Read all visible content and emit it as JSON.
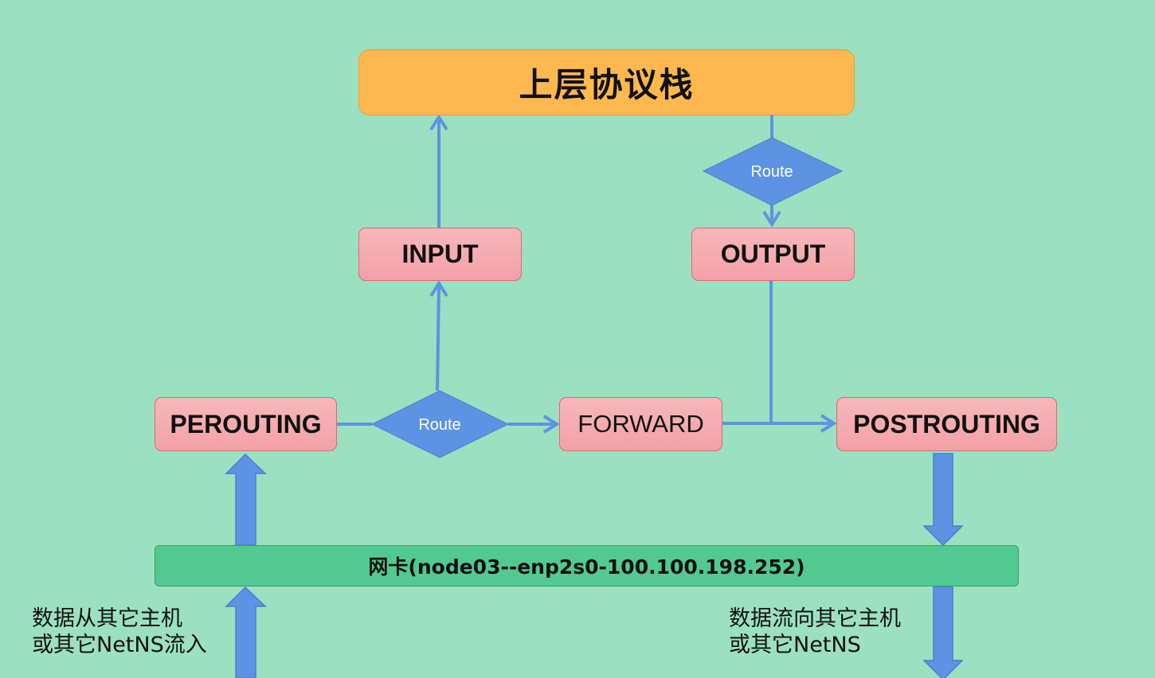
{
  "top_box": {
    "label": "上层协议栈"
  },
  "chains": {
    "input": "INPUT",
    "output": "OUTPUT",
    "prerouting": "PEROUTING",
    "forward": "FORWARD",
    "postrouting": "POSTROUTING"
  },
  "route_nodes": {
    "upper": "Route",
    "lower": "Route"
  },
  "nic": {
    "label": "网卡(node03--enp2s0-100.100.198.252)"
  },
  "notes": {
    "inbound": [
      "数据从其它主机",
      "或其它NetNS流入"
    ],
    "outbound": [
      "数据流向其它主机",
      "或其它NetNS"
    ]
  },
  "colors": {
    "background": "#9be0c1",
    "chain_fill": "#f4a9ae",
    "chain_border": "#e46670",
    "top_box_fill": "#ffb84f",
    "route_fill": "#5e93e3",
    "nic_fill": "#52c990",
    "arrow": "#5e93e3"
  }
}
